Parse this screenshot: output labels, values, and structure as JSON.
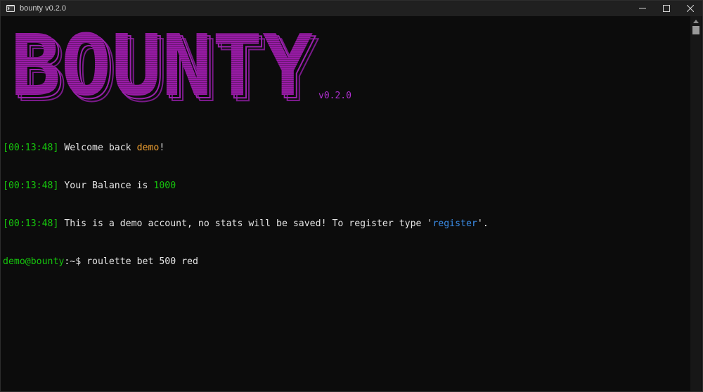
{
  "window": {
    "title": "bounty v0.2.0"
  },
  "banner": {
    "logo_text": "BOUNTY",
    "version": "v0.2.0",
    "logo_color": "#a21caf",
    "logo_shadow_color": "#c026d3"
  },
  "log": [
    {
      "timestamp": "[00:13:48]",
      "prefix": " Welcome back ",
      "highlight": "demo",
      "suffix": "!"
    },
    {
      "timestamp": "[00:13:48]",
      "prefix": " Your Balance is ",
      "highlight": "1000",
      "suffix": ""
    },
    {
      "timestamp": "[00:13:48]",
      "prefix": " This is a demo account, no stats will be saved! To register type '",
      "highlight": "register",
      "suffix": "'."
    }
  ],
  "prompt": {
    "user_host": "demo@bounty",
    "path_symbol": ":~$ ",
    "command": "roulette bet 500 red"
  },
  "colors": {
    "timestamp": "#16c60c",
    "username": "#f0a030",
    "balance": "#16c60c",
    "keyword": "#3b8eea",
    "text": "#e6e6e6",
    "background": "#0c0c0c"
  },
  "icons": {
    "app": "terminal-app-icon",
    "minimize": "minimize-icon",
    "maximize": "maximize-icon",
    "close": "close-icon",
    "scroll_up": "scroll-up-arrow-icon"
  }
}
